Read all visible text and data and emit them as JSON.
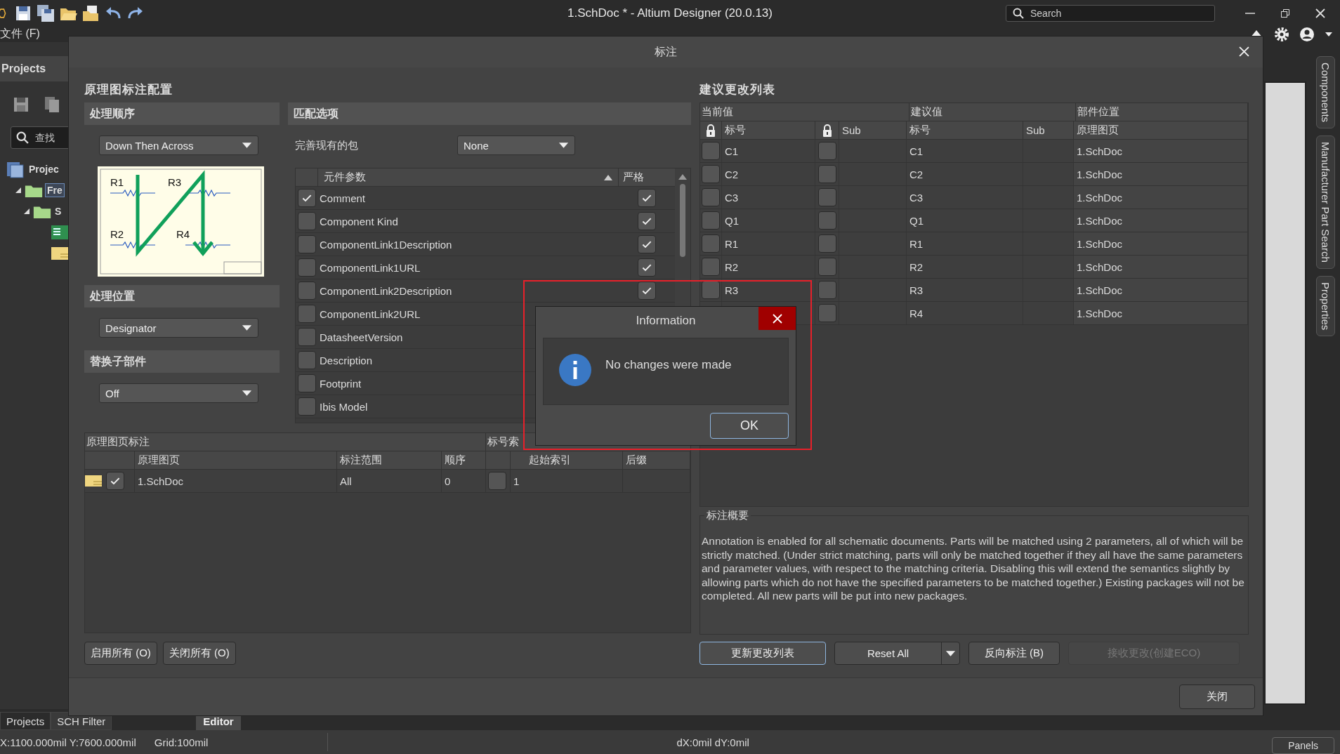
{
  "window": {
    "title": "1.SchDoc * - Altium Designer (20.0.13)",
    "search": {
      "placeholder": "Search"
    }
  },
  "menu": [
    "文件 (F)"
  ],
  "projects_panel": {
    "title": "Projects",
    "search": {
      "placeholder": "查找"
    },
    "tree": [
      {
        "label": "Projec",
        "children": [
          {
            "label": "Fre",
            "expanded": true,
            "selected": true,
            "children": [
              {
                "label": "S",
                "expanded": true,
                "selected": false
              }
            ]
          }
        ]
      }
    ]
  },
  "bottom_tabs": [
    {
      "label": "Projects",
      "selected": true
    },
    {
      "label": "SCH Filter",
      "selected": false
    }
  ],
  "editor_tabs": [
    {
      "label": "Editor",
      "selected": true
    }
  ],
  "side_tabs": [
    "Components",
    "Manufacturer Part Search",
    "Properties"
  ],
  "status_bar": {
    "coords": "X:1100.000mil Y:7600.000mil",
    "grid": "Grid:100mil",
    "delta": "dX:0mil dY:0mil",
    "panels_button": "Panels"
  },
  "dialog": {
    "title": "标注",
    "config": {
      "title": "原理图标注配置",
      "order": {
        "header": "处理顺序",
        "value": "Down Then Across",
        "preview_labels": [
          "R1",
          "R3",
          "R2",
          "R4"
        ]
      },
      "location": {
        "header": "处理位置",
        "value": "Designator"
      },
      "subparts": {
        "header": "替换子部件",
        "value": "Off"
      },
      "matching": {
        "header": "匹配选项",
        "package_label": "完善现有的包",
        "package_value": "None",
        "columns": [
          "元件参数",
          "严格"
        ],
        "params": [
          {
            "name": "Comment",
            "checked": true,
            "strict": true
          },
          {
            "name": "Component Kind",
            "checked": false,
            "strict": true
          },
          {
            "name": "ComponentLink1Description",
            "checked": false,
            "strict": true
          },
          {
            "name": "ComponentLink1URL",
            "checked": false,
            "strict": true
          },
          {
            "name": "ComponentLink2Description",
            "checked": false,
            "strict": true
          },
          {
            "name": "ComponentLink2URL",
            "checked": false
          },
          {
            "name": "DatasheetVersion",
            "checked": false
          },
          {
            "name": "Description",
            "checked": false
          },
          {
            "name": "Footprint",
            "checked": false
          },
          {
            "name": "Ibis Model",
            "checked": false
          }
        ]
      },
      "sheets": {
        "group_headers": [
          "原理图页标注",
          "标号索"
        ],
        "columns": [
          "原理图页",
          "标注范围",
          "顺序",
          "起始索引",
          "后缀"
        ],
        "rows": [
          {
            "enabled": true,
            "sheet": "1.SchDoc",
            "scope": "All",
            "order": "0",
            "start_index_on": false,
            "start_index": "1"
          }
        ]
      },
      "buttons": [
        "启用所有 (O)",
        "关闭所有 (O)"
      ]
    },
    "changes": {
      "title": "建议更改列表",
      "group_headers": [
        "当前值",
        "建议值",
        "部件位置"
      ],
      "columns": [
        "标号",
        "Sub",
        "标号",
        "Sub",
        "原理图页"
      ],
      "rows": [
        {
          "locked": false,
          "current": "C1",
          "sub_locked": false,
          "proposed": "C1",
          "sheet": "1.SchDoc"
        },
        {
          "locked": false,
          "current": "C2",
          "sub_locked": false,
          "proposed": "C2",
          "sheet": "1.SchDoc"
        },
        {
          "locked": false,
          "current": "C3",
          "sub_locked": false,
          "proposed": "C3",
          "sheet": "1.SchDoc"
        },
        {
          "locked": false,
          "current": "Q1",
          "sub_locked": false,
          "proposed": "Q1",
          "sheet": "1.SchDoc"
        },
        {
          "locked": false,
          "current": "R1",
          "sub_locked": false,
          "proposed": "R1",
          "sheet": "1.SchDoc"
        },
        {
          "locked": false,
          "current": "R2",
          "sub_locked": false,
          "proposed": "R2",
          "sheet": "1.SchDoc"
        },
        {
          "locked": false,
          "current": "R3",
          "sub_locked": false,
          "proposed": "R3",
          "sheet": "1.SchDoc"
        },
        {
          "sub_locked": false,
          "proposed": "R4",
          "sheet": "1.SchDoc"
        }
      ],
      "summary": {
        "title": "标注概要",
        "text": "Annotation is enabled for all schematic documents. Parts will be matched using 2 parameters, all of which will be strictly matched. (Under strict matching, parts will only be matched together if they all have the same parameters and parameter values, with respect to the matching criteria. Disabling this will extend the semantics slightly by allowing parts which do not have the specified parameters to be matched together.) Existing packages will not be completed. All new parts will be put into new packages."
      },
      "buttons": [
        {
          "label": "更新更改列表",
          "kind": "plain",
          "focused": true,
          "disabled": false
        },
        {
          "label": "Reset All",
          "kind": "split",
          "focused": false,
          "disabled": false
        },
        {
          "label": "反向标注 (B)",
          "kind": "plain",
          "focused": false,
          "disabled": false
        },
        {
          "label": "接收更改(创建ECO)",
          "kind": "plain",
          "focused": false,
          "disabled": true
        }
      ]
    },
    "close_button": "关闭"
  },
  "info": {
    "title": "Information",
    "message": "No changes were made",
    "ok_button": "OK"
  }
}
